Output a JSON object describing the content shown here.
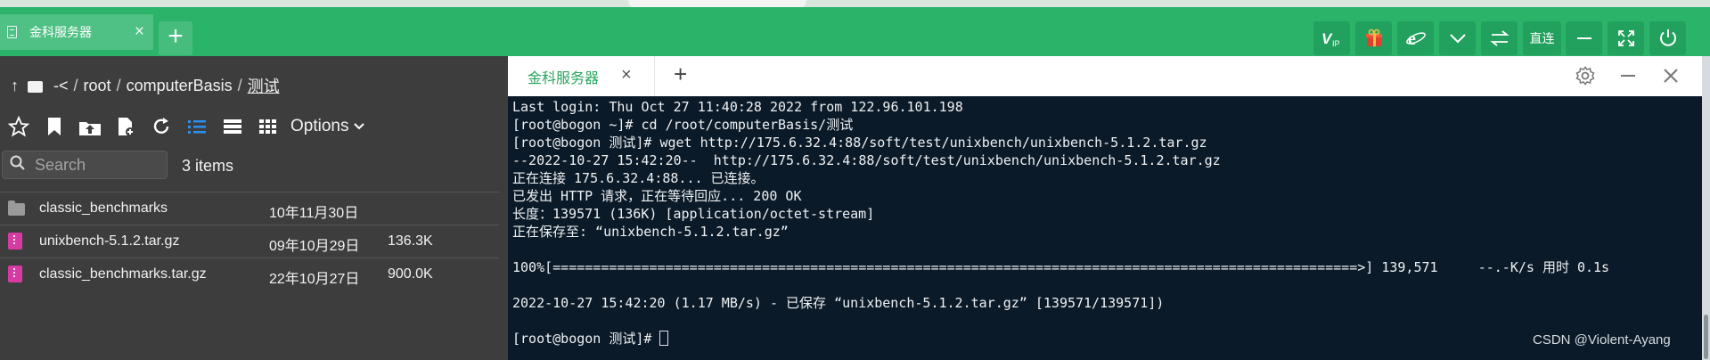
{
  "topbar": {
    "tab_label": "金科服务器",
    "tab_close": "×",
    "add_tab": "+",
    "direct_label": "直连",
    "icons": [
      "vip-icon",
      "gift-icon",
      "browser-icon",
      "chevron-down-icon",
      "swap-icon",
      "minimize-icon",
      "fullscreen-icon",
      "power-icon"
    ]
  },
  "filepanel": {
    "path": {
      "up": "↑",
      "root_marker": "-<",
      "sep": "/",
      "parts": [
        "root",
        "computerBasis",
        "测试"
      ]
    },
    "options_label": "Options",
    "search_placeholder": "Search",
    "items_count": "3 items",
    "files": [
      {
        "name": "classic_benchmarks",
        "date": "10年11月30日",
        "size": "",
        "type": "folder"
      },
      {
        "name": "unixbench-5.1.2.tar.gz",
        "date": "09年10月29日",
        "size": "136.3K",
        "type": "archive"
      },
      {
        "name": "classic_benchmarks.tar.gz",
        "date": "22年10月27日",
        "size": "900.0K",
        "type": "archive"
      }
    ]
  },
  "terminal": {
    "tab_label": "金科服务器",
    "tab_close": "×",
    "add_tab": "+",
    "lines": [
      "Last login: Thu Oct 27 11:40:28 2022 from 122.96.101.198",
      "[root@bogon ~]# cd /root/computerBasis/测试",
      "[root@bogon 测试]# wget http://175.6.32.4:88/soft/test/unixbench/unixbench-5.1.2.tar.gz",
      "--2022-10-27 15:42:20--  http://175.6.32.4:88/soft/test/unixbench/unixbench-5.1.2.tar.gz",
      "正在连接 175.6.32.4:88... 已连接。",
      "已发出 HTTP 请求，正在等待回应... 200 OK",
      "长度：139571 (136K) [application/octet-stream]",
      "正在保存至: “unixbench-5.1.2.tar.gz”",
      "",
      "100%[====================================================================================================>] 139,571     --.-K/s 用时 0.1s",
      "",
      "2022-10-27 15:42:20 (1.17 MB/s) - 已保存 “unixbench-5.1.2.tar.gz” [139571/139571])",
      ""
    ],
    "prompt": "[root@bogon 测试]# "
  },
  "watermark": "CSDN @Violent-Ayang"
}
